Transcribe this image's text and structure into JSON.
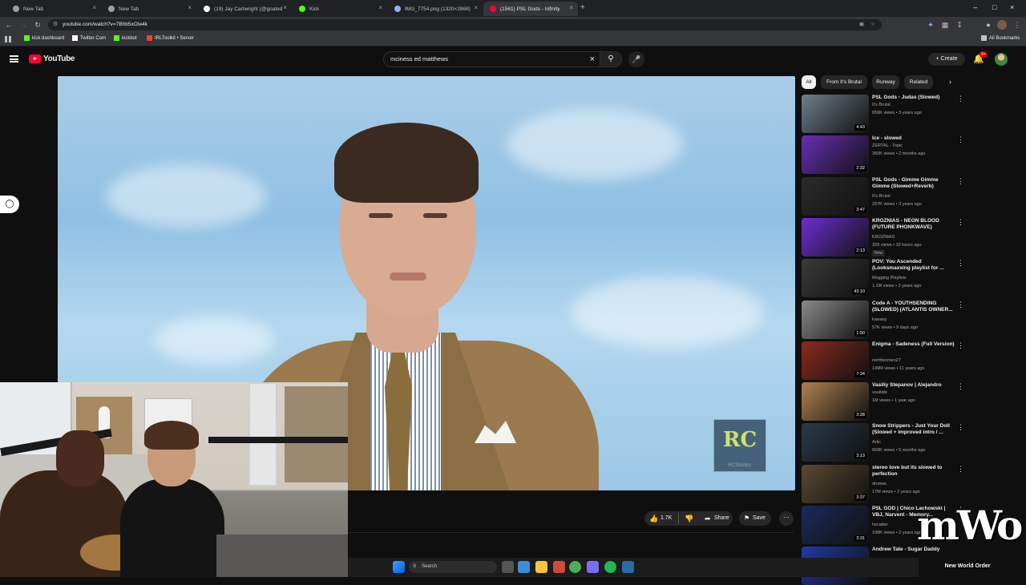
{
  "tabs": [
    {
      "title": "New Tab",
      "active": false,
      "favicon_color": "#9aa0a6"
    },
    {
      "title": "New Tab",
      "active": false,
      "favicon_color": "#9aa0a6"
    },
    {
      "title": "(19) Jay Cartwright (@goated)",
      "active": false,
      "favicon_color": "#ffffff"
    },
    {
      "title": "Kick",
      "active": false,
      "favicon_color": "#53fc18"
    },
    {
      "title": "IMG_7754.png (1320×2868)",
      "active": false,
      "favicon_color": "#8ab4f8"
    },
    {
      "title": "(1561) PSL Gods - Infinity",
      "active": true,
      "favicon_color": "#ff0033"
    }
  ],
  "address": {
    "url": "youtube.com/watch?v=7Bhb5xOIe4k"
  },
  "bookmarks": [
    {
      "label": "kick dashboard",
      "icon_color": "#53fc18"
    },
    {
      "label": "Twitter Com",
      "icon_color": "#ffffff"
    },
    {
      "label": "kickbot",
      "icon_color": "#53fc18"
    },
    {
      "label": "IRLToolkit • Server",
      "icon_color": "#ea4335"
    },
    {
      "label": "All Bookmarks",
      "icon_color": "#bdc1c6"
    }
  ],
  "youtube": {
    "logo": "YouTube",
    "search_value": "mciness ed matthews",
    "create_label": "Create",
    "notif_count": "9+"
  },
  "video": {
    "watermark": "RC",
    "watermark_sub": "RCStudios"
  },
  "actions": {
    "likes": "1.7K",
    "share_label": "Share",
    "save_label": "Save"
  },
  "chips": [
    {
      "label": "All",
      "active": true
    },
    {
      "label": "From It's Brutal",
      "active": false
    },
    {
      "label": "Runway",
      "active": false
    },
    {
      "label": "Related",
      "active": false
    }
  ],
  "recommendations": [
    {
      "title": "PSL Gods - Judas (Slowed)",
      "channel": "It's Brutal",
      "meta": "656K views • 3 years ago",
      "duration": "4:43",
      "thumb": "#6e7e8a",
      "new": false
    },
    {
      "title": "Ice - slowed",
      "channel": "ZERTAL - Topic",
      "meta": "360K views • 2 months ago",
      "duration": "2:32",
      "thumb": "#6a2fb5",
      "new": false
    },
    {
      "title": "PSL Gods - Gimme Gimme Gimme (Slowed+Reverb)",
      "channel": "It's Brutal",
      "meta": "297K views • 3 years ago",
      "duration": "3:47",
      "thumb": "#2b2b2b",
      "new": false
    },
    {
      "title": "KROZNIAS - NEON BLOOD (FUTURE PHONKWAVE)",
      "channel": "KROZNIAS",
      "meta": "329 views • 10 hours ago",
      "duration": "2:13",
      "thumb": "#6f2fd0",
      "new": true
    },
    {
      "title": "POV: You Ascended (Looksmaxxing playlist for ...",
      "channel": "Mogging Playlists",
      "meta": "1.1M views • 2 years ago",
      "duration": "43:10",
      "thumb": "#3a3a3a",
      "new": false
    },
    {
      "title": "Code A - YOUTHSENDING (SLOWED) (ATLANTIS OWNER...",
      "channel": "kawaxy",
      "meta": "57K views • 9 days ago",
      "duration": "1:50",
      "thumb": "#8a8a8a",
      "new": false
    },
    {
      "title": "Enigma - Sadeness (Full Version)",
      "channel": "northborneo27",
      "meta": "149M views • 11 years ago",
      "duration": "7:34",
      "thumb": "#8c2a1e",
      "new": false
    },
    {
      "title": "Vasiliy Stepanov | Alejandro",
      "channel": "soultide",
      "meta": "1M views • 1 year ago",
      "duration": "3:28",
      "thumb": "#b08050",
      "new": false
    },
    {
      "title": "Snow Strippers - Just Your Doll (Slowed + improved intro / ...",
      "channel": "Artic",
      "meta": "669K views • 5 months ago",
      "duration": "3:13",
      "thumb": "#2a3a4a",
      "new": false
    },
    {
      "title": "stereo love but its slowed to perfection",
      "channel": "drowse.",
      "meta": "17M views • 2 years ago",
      "duration": "3:37",
      "thumb": "#5a4a30",
      "new": false
    },
    {
      "title": "PSL GOD | Chico Lachowski | VBJ, Narvent - Memory...",
      "channel": "hecatier",
      "meta": "108K views • 2 years ago",
      "duration": "3:31",
      "thumb": "#1a2a5a",
      "new": false
    },
    {
      "title": "Andrew Tate - Sugar Daddy",
      "channel": "",
      "meta": "",
      "duration": "",
      "thumb": "#1e3aa8",
      "new": false
    }
  ],
  "taskbar": {
    "search_label": "Search"
  },
  "overlay_logo": {
    "text": "mWo",
    "sub": "New World Order"
  }
}
